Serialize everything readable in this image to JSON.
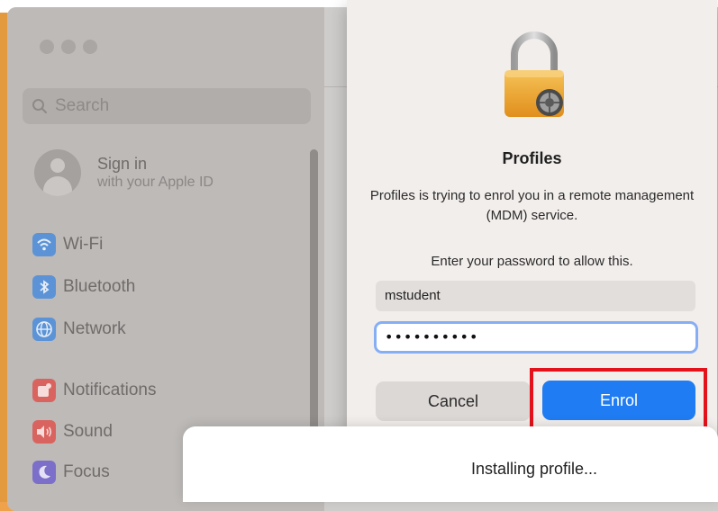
{
  "sidebar": {
    "search_placeholder": "Search",
    "signin_title": "Sign in",
    "signin_subtitle": "with your Apple ID",
    "items": [
      {
        "label": "Wi-Fi",
        "icon": "wifi-icon",
        "color": "#5b93d6"
      },
      {
        "label": "Bluetooth",
        "icon": "bluetooth-icon",
        "color": "#5b93d6"
      },
      {
        "label": "Network",
        "icon": "network-icon",
        "color": "#5b93d6"
      },
      {
        "label": "Notifications",
        "icon": "notifications-icon",
        "color": "#d9645f"
      },
      {
        "label": "Sound",
        "icon": "sound-icon",
        "color": "#d9645f"
      },
      {
        "label": "Focus",
        "icon": "focus-icon",
        "color": "#7c6fc9"
      }
    ]
  },
  "dialog": {
    "title": "Profiles",
    "message": "Profiles is trying to enrol you in a remote management (MDM) service.",
    "prompt": "Enter your password to allow this.",
    "username_value": "mstudent",
    "password_mask": "••••••••••",
    "cancel_label": "Cancel",
    "enrol_label": "Enrol",
    "accent_color": "#1f7cf2",
    "highlight_color": "#e3121b"
  },
  "progress": {
    "label": "Installing profile..."
  }
}
